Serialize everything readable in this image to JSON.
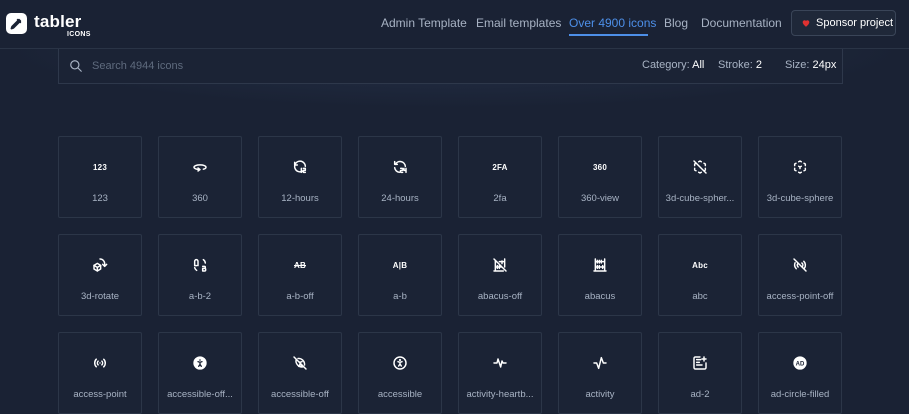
{
  "brand": {
    "name": "tabler",
    "sub": "ICONS"
  },
  "nav": [
    {
      "label": "Admin Template",
      "active": false
    },
    {
      "label": "Email templates",
      "active": false
    },
    {
      "label": "Over 4900 icons",
      "active": true
    },
    {
      "label": "Blog",
      "active": false
    },
    {
      "label": "Documentation",
      "active": false
    }
  ],
  "sponsor": {
    "label": "Sponsor project",
    "accent": "#e03131"
  },
  "search": {
    "placeholder": "Search 4944 icons",
    "category_label": "Category:",
    "category_value": "All",
    "stroke_label": "Stroke:",
    "stroke_value": "2",
    "size_label": "Size:",
    "size_value": "24px"
  },
  "colors": {
    "background": "#1a2234",
    "accent": "#4d8fe8",
    "card_border": "#2c3648"
  },
  "icons": [
    {
      "name": "123",
      "glyph": "123"
    },
    {
      "name": "360",
      "glyph": "360-icon"
    },
    {
      "name": "12-hours",
      "glyph": "12-hours-icon"
    },
    {
      "name": "24-hours",
      "glyph": "24-hours-icon"
    },
    {
      "name": "2fa",
      "glyph": "2FA"
    },
    {
      "name": "360-view",
      "glyph": "360"
    },
    {
      "name": "3d-cube-spher...",
      "glyph": "3d-cube-sphere-off-icon"
    },
    {
      "name": "3d-cube-sphere",
      "glyph": "3d-cube-sphere-icon"
    },
    {
      "name": "3d-rotate",
      "glyph": "3d-rotate-icon"
    },
    {
      "name": "a-b-2",
      "glyph": "a-b-2-icon"
    },
    {
      "name": "a-b-off",
      "glyph": "AB"
    },
    {
      "name": "a-b",
      "glyph": "A|B"
    },
    {
      "name": "abacus-off",
      "glyph": "abacus-off-icon"
    },
    {
      "name": "abacus",
      "glyph": "abacus-icon"
    },
    {
      "name": "abc",
      "glyph": "Abc"
    },
    {
      "name": "access-point-off",
      "glyph": "access-point-off-icon"
    },
    {
      "name": "access-point",
      "glyph": "access-point-icon"
    },
    {
      "name": "accessible-off...",
      "glyph": "accessible-filled-icon"
    },
    {
      "name": "accessible-off",
      "glyph": "accessible-off-icon"
    },
    {
      "name": "accessible",
      "glyph": "accessible-icon"
    },
    {
      "name": "activity-heartb...",
      "glyph": "activity-heartbeat-icon"
    },
    {
      "name": "activity",
      "glyph": "activity-icon"
    },
    {
      "name": "ad-2",
      "glyph": "ad-2-icon"
    },
    {
      "name": "ad-circle-filled",
      "glyph": "ad-circle-filled-icon"
    }
  ]
}
